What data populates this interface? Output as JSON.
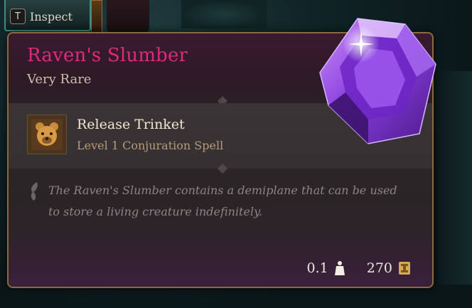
{
  "hotbar": {
    "key": "T",
    "label": "Inspect"
  },
  "item": {
    "name": "Raven's Slumber",
    "rarity": "Very Rare",
    "spell": {
      "name": "Release Trinket",
      "type": "Level 1 Conjuration Spell"
    },
    "description": "The Raven's Slumber contains a demiplane that can be used to store a living creature indefinitely.",
    "weight": "0.1",
    "value": "270"
  },
  "colors": {
    "title": "#e0287c",
    "rarity": "#c9bfae",
    "spell_sub": "#b89a7a",
    "border": "#8a6a3e",
    "gem": "#7b2fd0"
  },
  "icons": {
    "spell": "bear-head-icon",
    "description": "quill-icon",
    "weight": "weight-icon",
    "value": "gold-coin-icon",
    "item": "purple-gem-icon"
  }
}
